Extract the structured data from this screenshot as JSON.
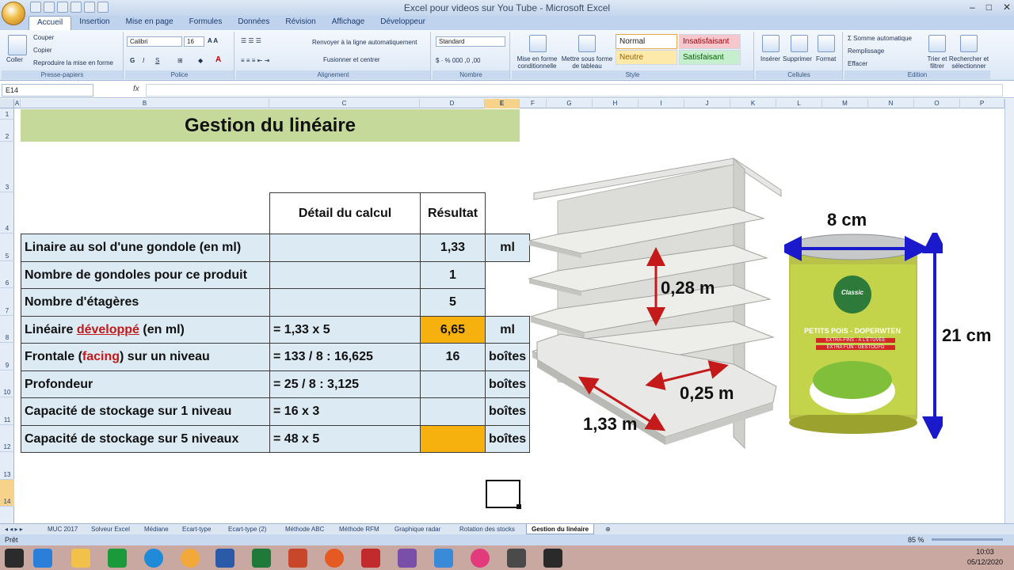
{
  "window": {
    "title": "Excel pour videos sur You Tube - Microsoft Excel"
  },
  "ribbon_tabs": [
    "Accueil",
    "Insertion",
    "Mise en page",
    "Formules",
    "Données",
    "Révision",
    "Affichage",
    "Développeur"
  ],
  "ribbon": {
    "clipboard": {
      "paste": "Coller",
      "cut": "Couper",
      "copy": "Copier",
      "format_painter": "Reproduire la mise en forme",
      "label": "Presse-papiers"
    },
    "font": {
      "name": "Calibri",
      "size": "16",
      "label": "Police"
    },
    "alignment": {
      "wrap": "Renvoyer à la ligne automatiquement",
      "merge": "Fusionner et centrer",
      "label": "Alignement"
    },
    "number": {
      "format": "Standard",
      "label": "Nombre"
    },
    "styles": {
      "conditional": "Mise en forme conditionnelle",
      "table": "Mettre sous forme de tableau",
      "normal": "Normal",
      "bad": "Insatisfaisant",
      "neutral": "Neutre",
      "good": "Satisfaisant",
      "label": "Style"
    },
    "cells": {
      "insert": "Insérer",
      "delete": "Supprimer",
      "format": "Format",
      "label": "Cellules"
    },
    "editing": {
      "autosum": "Somme automatique",
      "fill": "Remplissage",
      "clear": "Effacer",
      "sort": "Trier et filtrer",
      "find": "Rechercher et sélectionner",
      "label": "Edition"
    }
  },
  "formula_bar": {
    "name_box": "E14",
    "fx": "fx"
  },
  "columns": [
    "A",
    "B",
    "C",
    "D",
    "E",
    "F",
    "G",
    "H",
    "I",
    "J",
    "K",
    "L",
    "M",
    "N",
    "O",
    "P"
  ],
  "rows": [
    "1",
    "2",
    "3",
    "4",
    "5",
    "6",
    "7",
    "8",
    "9",
    "10",
    "11",
    "12",
    "13",
    "14"
  ],
  "sheet": {
    "title": "Gestion du linéaire",
    "header_calc": "Détail du calcul",
    "header_result": "Résultat",
    "table": [
      {
        "label": "Linaire au sol d'une gondole (en ml)",
        "calc": "",
        "result": "1,33",
        "unit": "ml"
      },
      {
        "label": "Nombre de gondoles pour ce produit",
        "calc": "",
        "result": "1",
        "unit": ""
      },
      {
        "label": "Nombre d'étagères",
        "calc": "",
        "result": "5",
        "unit": ""
      },
      {
        "label_pre": "Linéaire ",
        "label_red": "développé",
        "label_post": " (en ml)",
        "calc": "= 1,33 x 5",
        "result": "6,65",
        "unit": "ml"
      },
      {
        "label_pre": "Frontale (",
        "label_red": "facing",
        "label_post": ") sur un niveau",
        "calc": "= 133 / 8 : 16,625",
        "result": "16",
        "unit": "boîtes"
      },
      {
        "label": "Profondeur",
        "calc": "= 25 / 8 : 3,125",
        "result": "",
        "unit": "boîtes"
      },
      {
        "label": "Capacité de stockage sur 1 niveau",
        "calc": "= 16 x 3",
        "result": "",
        "unit": "boîtes"
      },
      {
        "label": "Capacité de stockage sur 5 niveaux",
        "calc": "= 48 x 5",
        "result": "",
        "unit": "boîtes"
      }
    ]
  },
  "illustration": {
    "shelf_height": "0,28 m",
    "shelf_depth": "0,25 m",
    "shelf_length": "1,33 m",
    "can_width": "8 cm",
    "can_height": "21 cm",
    "can_brand": "Classic",
    "can_product": "PETITS POIS - DOPERWTEN",
    "can_sub1": "EXTRA-FINS - À L'ÉTUVÉE",
    "can_sub2": "EXTRA FIJN - GESTOOFD"
  },
  "sheet_tabs": [
    "MUC 2017",
    "Solveur Excel",
    "Médiane",
    "Ecart-type",
    "Ecart-type (2)",
    "Méthode ABC",
    "Méthode RFM",
    "Graphique radar",
    "Rotation des stocks",
    "Gestion du linéaire"
  ],
  "status": {
    "ready": "Prêt",
    "zoom": "85 %"
  },
  "clock": {
    "time": "10:03",
    "date": "05/12/2020"
  },
  "colors": {
    "title_bg": "#c4d99a",
    "cell_bg": "#dbeaf3",
    "highlight": "#f7b10f",
    "arrow_red": "#c41a1a",
    "arrow_blue": "#1a1acc"
  }
}
